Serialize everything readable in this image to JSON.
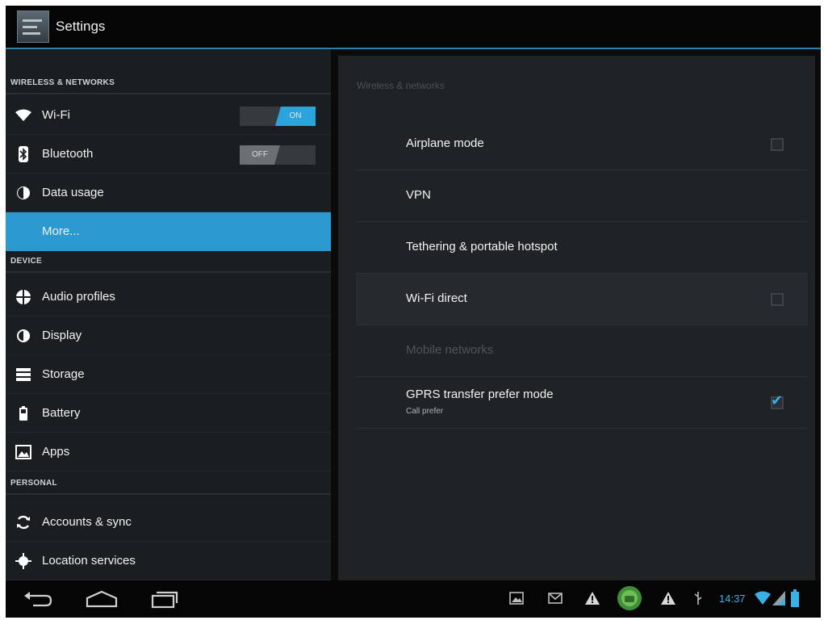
{
  "app": {
    "title": "Settings"
  },
  "sidebar": {
    "sections": [
      {
        "header": "WIRELESS & NETWORKS"
      },
      {
        "header": "DEVICE"
      },
      {
        "header": "PERSONAL"
      }
    ],
    "items": [
      {
        "label": "Wi-Fi",
        "icon": "wifi-icon",
        "toggle": "ON"
      },
      {
        "label": "Bluetooth",
        "icon": "bluetooth-icon",
        "toggle": "OFF"
      },
      {
        "label": "Data usage",
        "icon": "data-usage-icon"
      },
      {
        "label": "More...",
        "selected": true
      },
      {
        "label": "Audio profiles",
        "icon": "audio-profiles-icon"
      },
      {
        "label": "Display",
        "icon": "display-icon"
      },
      {
        "label": "Storage",
        "icon": "storage-icon"
      },
      {
        "label": "Battery",
        "icon": "battery-icon"
      },
      {
        "label": "Apps",
        "icon": "apps-icon"
      },
      {
        "label": "Accounts & sync",
        "icon": "sync-icon"
      },
      {
        "label": "Location services",
        "icon": "location-icon"
      }
    ]
  },
  "main": {
    "heading": "Wireless & networks",
    "rows": [
      {
        "title": "Airplane mode",
        "checkbox": "unchecked"
      },
      {
        "title": "VPN"
      },
      {
        "title": "Tethering & portable hotspot"
      },
      {
        "title": "Wi-Fi direct",
        "checkbox": "unchecked"
      },
      {
        "title": "Mobile networks",
        "disabled": true
      },
      {
        "title": "GPRS transfer prefer mode",
        "subtitle": "Call prefer",
        "checkbox": "checked"
      }
    ]
  },
  "systembar": {
    "time": "14:37",
    "nav": [
      "back-icon",
      "home-icon",
      "recent-apps-icon"
    ],
    "notifications": [
      "image-icon",
      "mail-icon",
      "warning-icon",
      "android-debug-icon",
      "warning-icon",
      "usb-icon"
    ],
    "status": [
      "wifi-signal-icon",
      "cell-signal-icon",
      "battery-icon"
    ]
  },
  "colors": {
    "accent": "#2c9ad0",
    "toggle_on": "#2ba3dc",
    "clock": "#3ab1e6",
    "background": "#1b1e21"
  }
}
